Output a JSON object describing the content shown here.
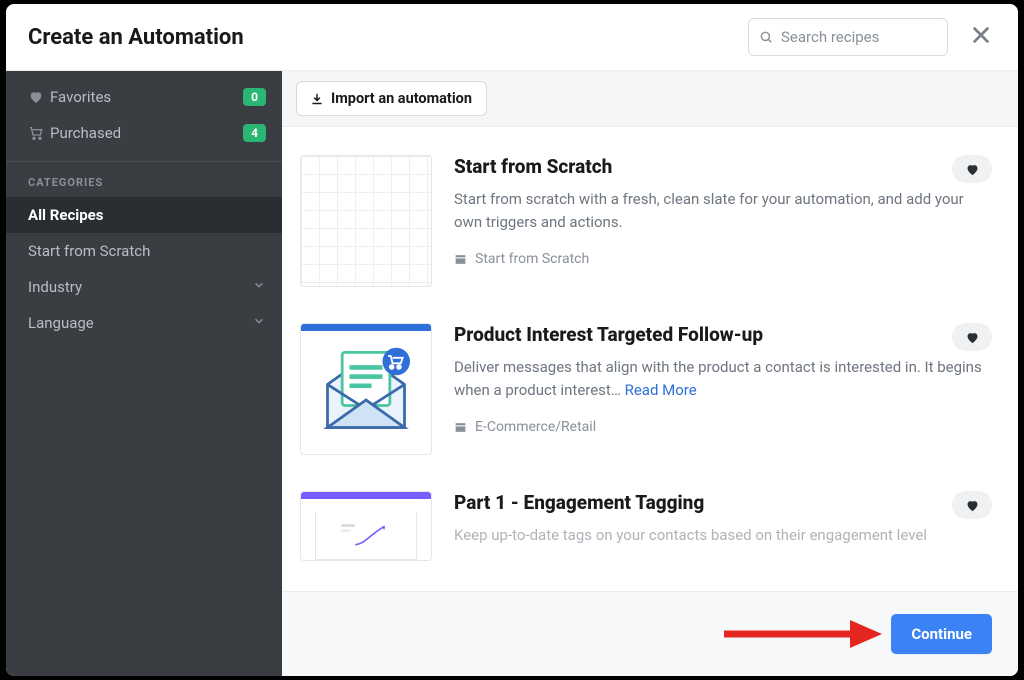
{
  "header": {
    "title": "Create an Automation",
    "search_placeholder": "Search recipes"
  },
  "sidebar": {
    "favorites": {
      "label": "Favorites",
      "count": "0"
    },
    "purchased": {
      "label": "Purchased",
      "count": "4"
    },
    "categories_heading": "CATEGORIES",
    "items": [
      {
        "label": "All Recipes"
      },
      {
        "label": "Start from Scratch"
      },
      {
        "label": "Industry"
      },
      {
        "label": "Language"
      }
    ]
  },
  "toolbar": {
    "import_label": "Import an automation"
  },
  "recipes": [
    {
      "title": "Start from Scratch",
      "desc": "Start from scratch with a fresh, clean slate for your automation, and add your own triggers and actions.",
      "category": "Start from Scratch",
      "accent": "#ffffff",
      "thumb": "grid"
    },
    {
      "title": "Product Interest Targeted Follow-up",
      "desc": "Deliver messages that align with the product a contact is interested in. It begins when a product interest… ",
      "read_more": "Read More",
      "category": "E-Commerce/Retail",
      "accent": "#2f6fd8",
      "thumb": "envelope"
    },
    {
      "title": "Part 1 - Engagement Tagging",
      "desc": "Keep up-to-date tags on your contacts based on their engagement level",
      "category": "",
      "accent": "#7b5cff",
      "thumb": "engagement"
    }
  ],
  "footer": {
    "continue_label": "Continue"
  },
  "colors": {
    "primary": "#3b82f6",
    "badge": "#2bb673",
    "arrow": "#e3261f"
  }
}
